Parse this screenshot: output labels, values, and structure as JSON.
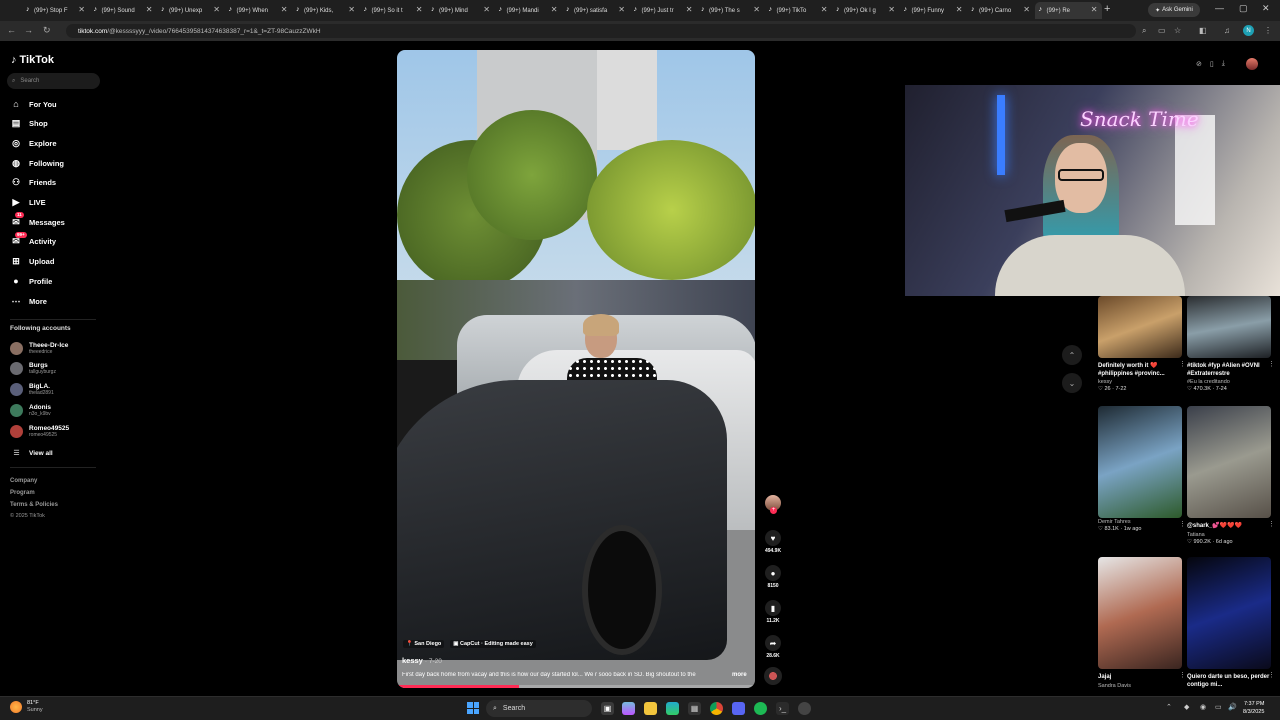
{
  "browser": {
    "tabs": [
      {
        "title": "(99+) Stop F"
      },
      {
        "title": "(99+) Sound"
      },
      {
        "title": "(99+) Unexp"
      },
      {
        "title": "(99+) When"
      },
      {
        "title": "(99+) Kids,"
      },
      {
        "title": "(99+) So it t"
      },
      {
        "title": "(99+) Mind"
      },
      {
        "title": "(99+) Mandi"
      },
      {
        "title": "(99+) satisfa"
      },
      {
        "title": "(99+) Just tr"
      },
      {
        "title": "(99+) The s"
      },
      {
        "title": "(99+) TikTo"
      },
      {
        "title": "(99+) Ok I g"
      },
      {
        "title": "(99+) Funny"
      },
      {
        "title": "(99+) Carno"
      },
      {
        "title": "(99+) Re"
      }
    ],
    "ask_gemini": "Ask Gemini",
    "url_host": "tiktok.com",
    "url_path": "/@kessssyyy_/video/7664539581437463838​7_r=1&_t=ZT-98CauzzZWkH",
    "profile_initial": "N"
  },
  "sidebar": {
    "brand": "TikTok",
    "search_placeholder": "Search",
    "nav": [
      {
        "label": "For You",
        "icon": "home-icon"
      },
      {
        "label": "Shop",
        "icon": "shop-icon"
      },
      {
        "label": "Explore",
        "icon": "compass-icon"
      },
      {
        "label": "Following",
        "icon": "following-icon"
      },
      {
        "label": "Friends",
        "icon": "friends-icon"
      },
      {
        "label": "LIVE",
        "icon": "live-icon"
      },
      {
        "label": "Messages",
        "icon": "messages-icon",
        "badge": "11"
      },
      {
        "label": "Activity",
        "icon": "activity-icon",
        "badge": "99+"
      },
      {
        "label": "Upload",
        "icon": "upload-icon"
      },
      {
        "label": "Profile",
        "icon": "profile-icon"
      },
      {
        "label": "More",
        "icon": "more-icon"
      }
    ],
    "following_title": "Following accounts",
    "accounts": [
      {
        "name": "Theee-Dr-Ice",
        "handle": "theeedrice",
        "color": "#8a6f62"
      },
      {
        "name": "Burgs",
        "handle": "tallguyburgz",
        "color": "#6a6a70"
      },
      {
        "name": "BigLA.",
        "handle": "thelad2891",
        "color": "#5a5f7a"
      },
      {
        "name": "Adonis",
        "handle": "n3o_k9bv",
        "color": "#3d7a5c"
      },
      {
        "name": "Romeo49525",
        "handle": "romeo49525",
        "color": "#b0403a"
      }
    ],
    "view_all": "View all",
    "footer": [
      "Company",
      "Program",
      "Terms & Policies"
    ],
    "copyright": "© 2025 TikTok"
  },
  "video": {
    "tags": [
      "San Diego",
      "CapCut · Editing made easy"
    ],
    "author": "kessy",
    "date": "· 7-20",
    "description": "First day back home from vacay and this is how our day started lol... We r sooo back in SD. Big shoutout to the",
    "more": "more",
    "progress": 0.34
  },
  "actions": {
    "likes": "494.9K",
    "comments": "8150",
    "saves": "11.2K",
    "shares": "28.6K"
  },
  "recommendations": [
    {
      "title": "Definitely worth it ❤️ #philippines #provinc...",
      "author": "kessy",
      "stats": "♡ 26 · 7-22",
      "thumb": "linear-gradient(160deg,#6b4a2a,#c9a06a,#3c2a1a)"
    },
    {
      "title": "#tiktok #fyp #Alien #OVNI #Extraterrestre",
      "author": "#Eu la creditando",
      "stats": "♡ 470.3K · 7-24",
      "thumb": "linear-gradient(170deg,#2a2d30,#8a9ea8,#1d2024)"
    },
    {
      "title": "",
      "author": "Demir Tahres",
      "stats": "♡ 83.1K · 1w ago",
      "thumb": "linear-gradient(160deg,#1e2a33,#7aa3c4,#2d5a2a)"
    },
    {
      "title": "@shark_💕❤️❤️❤️",
      "author": "Tatiana",
      "stats": "♡ 990.2K · 6d ago",
      "thumb": "linear-gradient(160deg,#3a3f4a,#9a9a8f,#575048)"
    },
    {
      "title": "Jajaj",
      "author": "Sandra Davis",
      "stats": "",
      "thumb": "linear-gradient(160deg,#e6e6e6,#b06a52,#3a2520)"
    },
    {
      "title": "Quiero darte un beso, perder contigo mi...",
      "author": "",
      "stats": "",
      "thumb": "linear-gradient(160deg,#05060d,#1a2b88,#0a0a1a)"
    }
  ],
  "taskbar": {
    "temp": "81°F",
    "weather": "Sunny",
    "search": "Search",
    "time": "7:37 PM",
    "date": "8/3/2025"
  }
}
